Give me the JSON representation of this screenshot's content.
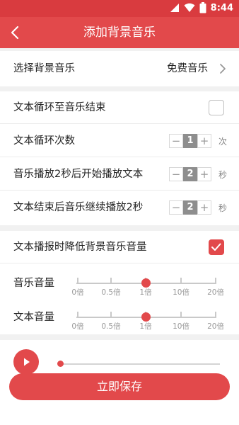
{
  "status_bar": {
    "time": "8:44"
  },
  "app_bar": {
    "title": "添加背景音乐"
  },
  "bg_music": {
    "label": "选择背景音乐",
    "value": "免费音乐"
  },
  "loop_to_end": {
    "label": "文本循环至音乐结束",
    "checked": false
  },
  "loop_count": {
    "label": "文本循环次数",
    "value": "1",
    "unit": "次",
    "minus": "−",
    "plus": "+"
  },
  "music_delay": {
    "label": "音乐播放2秒后开始播放文本",
    "value": "2",
    "unit": "秒",
    "minus": "−",
    "plus": "+"
  },
  "after_text": {
    "label": "文本结束后音乐继续播放2秒",
    "value": "2",
    "unit": "秒",
    "minus": "−",
    "plus": "+"
  },
  "lower_volume": {
    "label": "文本播报时降低背景音乐音量",
    "checked": true
  },
  "music_volume": {
    "label": "音乐音量",
    "ticks": [
      "0倍",
      "0.5倍",
      "1倍",
      "10倍",
      "20倍"
    ],
    "selected_index": 2
  },
  "text_volume": {
    "label": "文本音量",
    "ticks": [
      "0倍",
      "0.5倍",
      "1倍",
      "10倍",
      "20倍"
    ],
    "selected_index": 2
  },
  "player": {
    "progress": 0.0
  },
  "save_button": {
    "label": "立即保存"
  },
  "colors": {
    "accent": "#e2494b",
    "status_bar": "#d93b3f"
  }
}
